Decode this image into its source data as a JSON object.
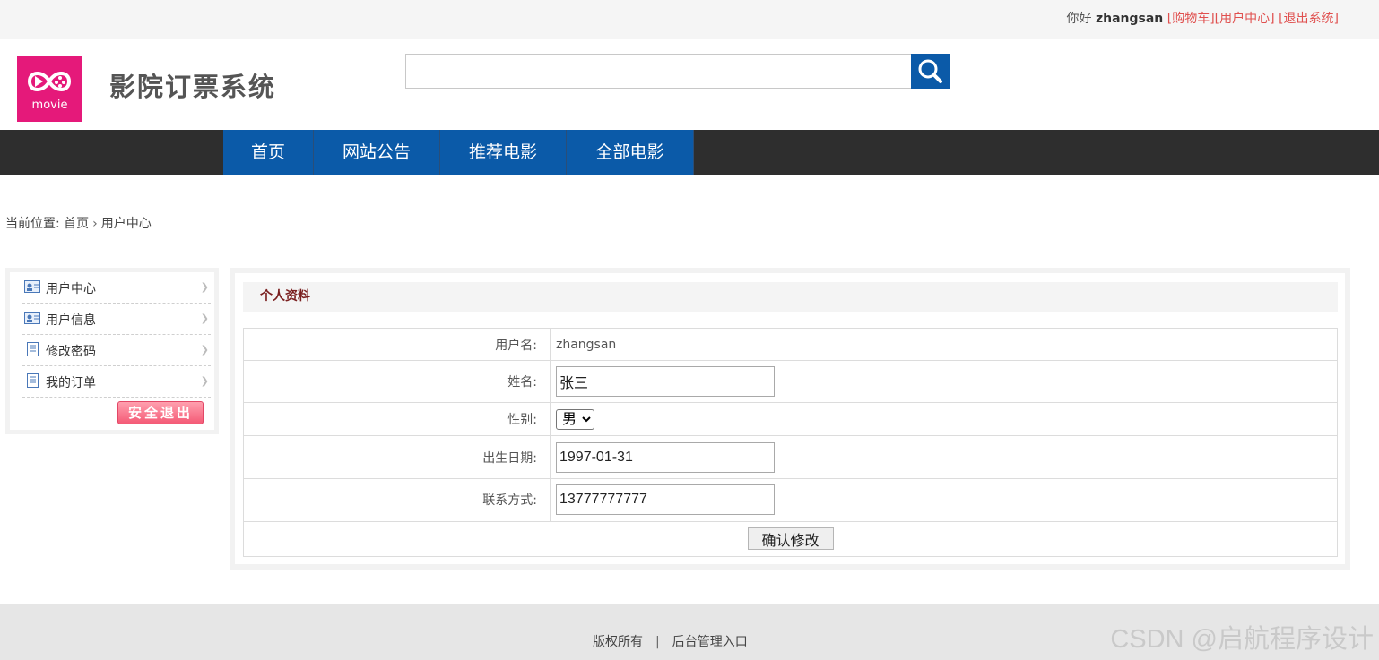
{
  "topbar": {
    "greeting": "你好",
    "username": "zhangsan",
    "cart_link": "[购物车]",
    "user_center_link": "[用户中心]",
    "logout_link": "[退出系统]"
  },
  "header": {
    "logo_text": "movie",
    "site_title": "影院订票系统",
    "search_placeholder": "",
    "search_value": ""
  },
  "nav": {
    "items": [
      {
        "label": "首页"
      },
      {
        "label": "网站公告"
      },
      {
        "label": "推荐电影"
      },
      {
        "label": "全部电影"
      }
    ]
  },
  "breadcrumb": {
    "prefix": "当前位置:",
    "home": "首页",
    "separator": "›",
    "current": "用户中心"
  },
  "sidebar": {
    "items": [
      {
        "label": "用户中心",
        "icon": "user-card-icon"
      },
      {
        "label": "用户信息",
        "icon": "user-card-icon"
      },
      {
        "label": "修改密码",
        "icon": "document-icon"
      },
      {
        "label": "我的订单",
        "icon": "document-icon"
      }
    ],
    "arrow": "❯",
    "logout_label": "安全退出"
  },
  "profile": {
    "title": "个人资料",
    "fields": {
      "username_label": "用户名:",
      "username_value": "zhangsan",
      "name_label": "姓名:",
      "name_value": "张三",
      "gender_label": "性别:",
      "gender_value": "男",
      "birth_label": "出生日期:",
      "birth_value": "1997-01-31",
      "contact_label": "联系方式:",
      "contact_value": "13777777777"
    },
    "submit_label": "确认修改"
  },
  "footer": {
    "copyright": "版权所有",
    "pipe": "|",
    "admin_link": "后台管理入口",
    "watermark": "CSDN @启航程序设计"
  },
  "colors": {
    "nav_blue": "#0b5aa8",
    "nav_bar": "#2e2e2e",
    "logo_pink": "#e5197a",
    "link_red": "#e0504f",
    "panel_title": "#7a1f1f"
  }
}
